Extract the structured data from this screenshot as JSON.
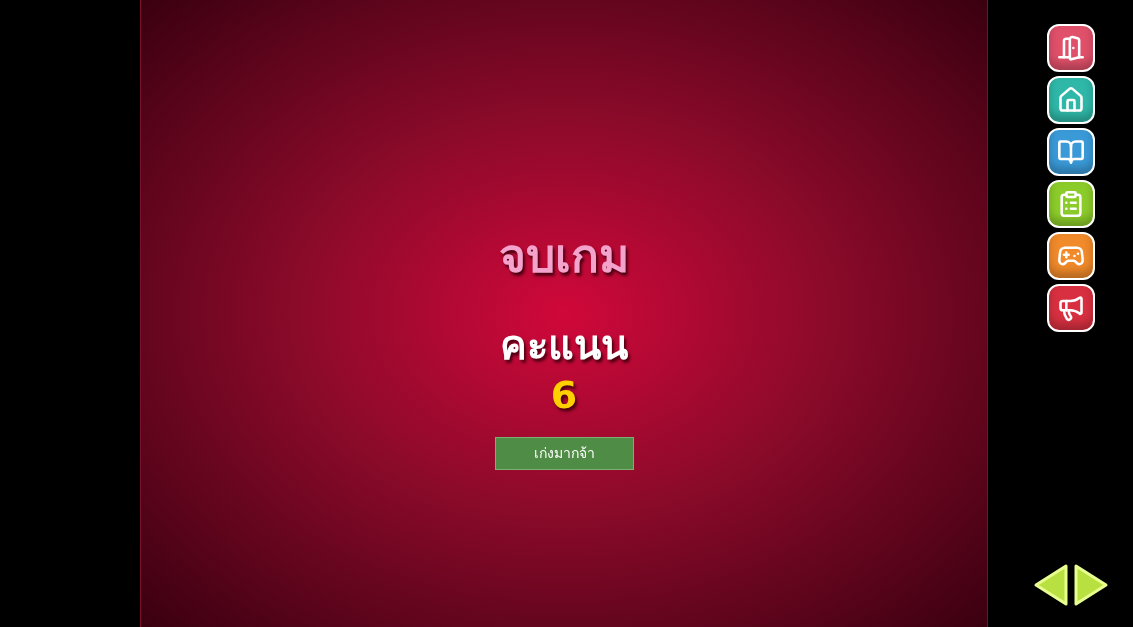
{
  "title": "จบเกม",
  "score_label": "คะแนน",
  "score": "6",
  "button": {
    "label": "เก่งมากจ้า"
  },
  "side_buttons": [
    {
      "kind": "exit",
      "color": "#e0506a"
    },
    {
      "kind": "home",
      "color": "#2fb8a8"
    },
    {
      "kind": "book",
      "color": "#3a9ad8"
    },
    {
      "kind": "list",
      "color": "#8ccc2a"
    },
    {
      "kind": "game",
      "color": "#f08a2a"
    },
    {
      "kind": "sound",
      "color": "#d83040"
    }
  ],
  "nav": [
    {
      "kind": "prev"
    },
    {
      "kind": "next"
    }
  ]
}
